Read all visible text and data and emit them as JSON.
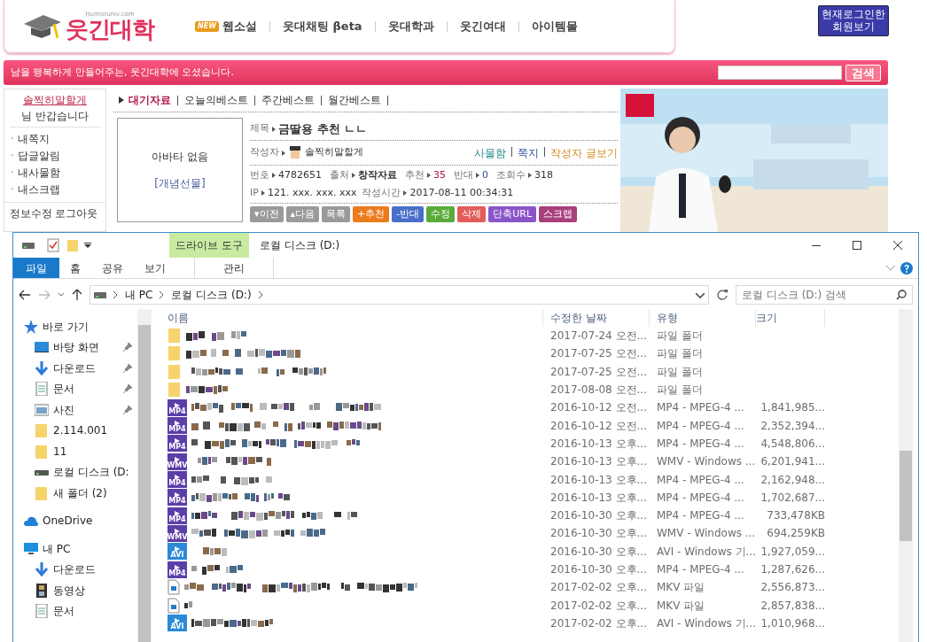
{
  "site": {
    "logo_domain": "Humoruniv.com",
    "logo_text": "웃긴대학",
    "nav": [
      {
        "label": "웹소설",
        "badge": "NEW"
      },
      {
        "label": "웃대채팅 βeta"
      },
      {
        "label": "웃대학과"
      },
      {
        "label": "웃긴여대"
      },
      {
        "label": "아이템몰"
      }
    ],
    "online_button": [
      "현재로그인한",
      "회원보기"
    ],
    "banner": "남을 행복하게 만들어주는, 웃긴대학에 오셨습니다.",
    "search_button": "검색",
    "user": {
      "name": "솔찍히말할게",
      "greeting": "님 반갑습니다",
      "menu": [
        "ㆍ내쪽지",
        "ㆍ답글알림",
        "ㆍ내사물함",
        "ㆍ내스크랩"
      ],
      "links": [
        "정보수정",
        "로그아웃"
      ]
    },
    "tabs": [
      {
        "label": "대기자료",
        "selected": true
      },
      {
        "label": "오늘의베스트",
        "selected": false
      },
      {
        "label": "주간베스트",
        "selected": false
      },
      {
        "label": "월간베스트",
        "selected": false
      }
    ],
    "post": {
      "avatar": "아바타 없음",
      "gift": "[개념선물]",
      "title_label": "제목",
      "title": "금딸용 추천 ㄴㄴ",
      "author_label": "작성자",
      "author": "솔찍히말할게",
      "author_links": [
        "사물함",
        "쪽지",
        "작성자 글보기"
      ],
      "meta": [
        {
          "label": "번호",
          "value": "4782651"
        },
        {
          "label": "출처",
          "value": "창작자료",
          "kind": "bold"
        },
        {
          "label": "추천",
          "value": "35",
          "kind": "up"
        },
        {
          "label": "반대",
          "value": "0",
          "kind": "down"
        },
        {
          "label": "조회수",
          "value": "318"
        }
      ],
      "ip_label": "IP",
      "ip": "121. xxx. xxx. xxx",
      "time_label": "작성시간",
      "time": "2017-08-11 00:34:31",
      "buttons": [
        {
          "label": "▾이전",
          "color": "#9a9a9a"
        },
        {
          "label": "▴다음",
          "color": "#9a9a9a"
        },
        {
          "label": "목록",
          "color": "#9a9a9a"
        },
        {
          "label": "+추천",
          "color": "#ec7b1c"
        },
        {
          "label": "-반대",
          "color": "#4a6fc9"
        },
        {
          "label": "수정",
          "color": "#5aaa3c"
        },
        {
          "label": "삭제",
          "color": "#e35b5b"
        },
        {
          "label": "단축URL",
          "color": "#8a55c9"
        },
        {
          "label": "스크랩",
          "color": "#a8407e"
        }
      ]
    },
    "ad": {
      "kind": "picture"
    }
  },
  "explorer": {
    "title": "로컬 디스크 (D:)",
    "context_tab": "드라이브 도구",
    "ribbon_tabs": [
      {
        "label": "파일",
        "kind": "file"
      },
      {
        "label": "홈",
        "kind": "tab"
      },
      {
        "label": "공유",
        "kind": "tab"
      },
      {
        "label": "보기",
        "kind": "tab"
      },
      {
        "label": "관리",
        "kind": "context"
      }
    ],
    "path": [
      "내 PC",
      "로컬 디스크 (D:)"
    ],
    "search": {
      "placeholder": "로컬 디스크 (D:) 검색"
    },
    "nav": [
      {
        "label": "바로 가기",
        "kind": "quick",
        "pinned": false,
        "children": [
          {
            "label": "바탕 화면",
            "kind": "desktop",
            "pinned": true
          },
          {
            "label": "다운로드",
            "kind": "download",
            "pinned": true
          },
          {
            "label": "문서",
            "kind": "document",
            "pinned": true
          },
          {
            "label": "사진",
            "kind": "picture",
            "pinned": true
          },
          {
            "label": "2.114.001",
            "kind": "folder",
            "pinned": false
          },
          {
            "label": "11",
            "kind": "folder",
            "pinned": false
          },
          {
            "label": "로컬 디스크 (D:",
            "kind": "drive",
            "pinned": false
          },
          {
            "label": "새 폴더 (2)",
            "kind": "folder",
            "pinned": false
          }
        ]
      },
      {
        "label": "OneDrive",
        "kind": "cloud",
        "pinned": false
      },
      {
        "label": "내 PC",
        "kind": "pc",
        "pinned": false,
        "children": [
          {
            "label": "다운로드",
            "kind": "download",
            "pinned": false
          },
          {
            "label": "동영상",
            "kind": "video",
            "pinned": false
          },
          {
            "label": "문서",
            "kind": "document",
            "pinned": false
          }
        ]
      }
    ],
    "columns": [
      "이름",
      "수정한 날짜",
      "유형",
      "크기"
    ],
    "rows": [
      {
        "kind": "folder",
        "date": "2017-07-24 오전...",
        "type": "파일 폴더"
      },
      {
        "kind": "folder",
        "date": "2017-07-25 오전...",
        "type": "파일 폴더"
      },
      {
        "kind": "folder",
        "date": "2017-07-25 오전...",
        "type": "파일 폴더"
      },
      {
        "kind": "folder",
        "date": "2017-08-08 오전...",
        "type": "파일 폴더"
      },
      {
        "kind": "video",
        "badge": "MP4",
        "date": "2016-10-12 오전...",
        "type": "MP4 - MPEG-4 ...",
        "size": "1,841,985..."
      },
      {
        "kind": "video",
        "badge": "MP4",
        "date": "2016-10-12 오전...",
        "type": "MP4 - MPEG-4 ...",
        "size": "2,352,394..."
      },
      {
        "kind": "video",
        "badge": "MP4",
        "date": "2016-10-13 오후...",
        "type": "MP4 - MPEG-4 ...",
        "size": "4,548,806..."
      },
      {
        "kind": "video",
        "badge": "WMV",
        "date": "2016-10-13 오후...",
        "type": "WMV - Windows ...",
        "size": "6,201,941..."
      },
      {
        "kind": "video",
        "badge": "MP4",
        "date": "2016-10-13 오후...",
        "type": "MP4 - MPEG-4 ...",
        "size": "2,162,948..."
      },
      {
        "kind": "video",
        "badge": "MP4",
        "date": "2016-10-13 오후...",
        "type": "MP4 - MPEG-4 ...",
        "size": "1,702,687..."
      },
      {
        "kind": "video",
        "badge": "MP4",
        "date": "2016-10-30 오후...",
        "type": "MP4 - MPEG-4 ...",
        "size": "733,478KB"
      },
      {
        "kind": "video",
        "badge": "WMV",
        "date": "2016-10-30 오후...",
        "type": "WMV - Windows ...",
        "size": "694,259KB"
      },
      {
        "kind": "avi",
        "badge": "AVI",
        "date": "2016-10-30 오후...",
        "type": "AVI - Windows 기...",
        "size": "1,927,059..."
      },
      {
        "kind": "video",
        "badge": "MP4",
        "date": "2016-10-30 오후...",
        "type": "MP4 - MPEG-4 ...",
        "size": "1,287,626..."
      },
      {
        "kind": "file",
        "date": "2017-02-02 오후...",
        "type": "MKV 파일",
        "size": "2,556,873..."
      },
      {
        "kind": "file",
        "date": "2017-02-02 오후...",
        "type": "MKV 파일",
        "size": "2,857,838..."
      },
      {
        "kind": "avi",
        "badge": "AVI",
        "date": "2017-02-02 오후...",
        "type": "AVI - Windows 기...",
        "size": "1,010,968..."
      }
    ]
  }
}
